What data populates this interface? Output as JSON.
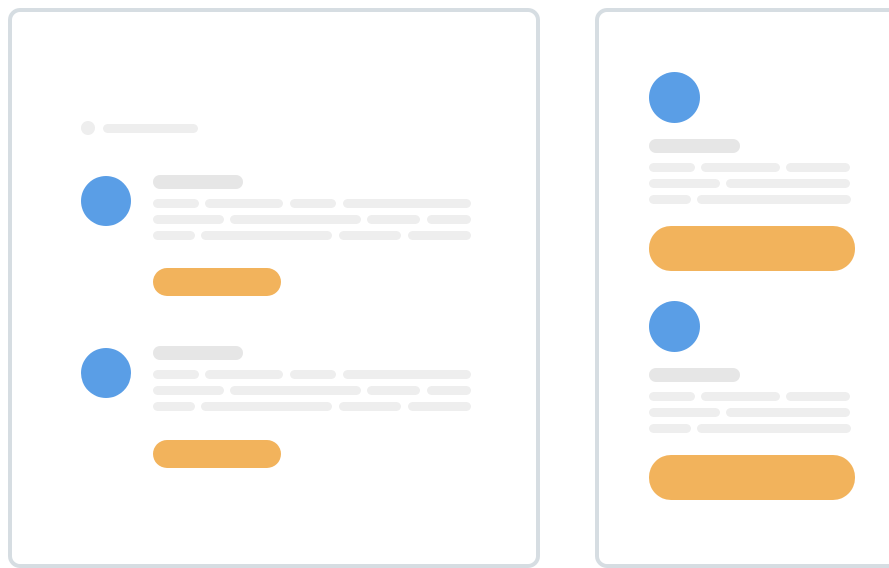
{
  "colors": {
    "frame_border": "#d6dde2",
    "avatar": "#5a9ee6",
    "cta": "#f2b35c",
    "placeholder": "#eeeeee",
    "background": "#ffffff"
  },
  "desktop_layout": {
    "header_placeholder": "breadcrumb-dot-and-text",
    "cards": [
      {
        "avatar": "avatar-icon",
        "title": "placeholder-title",
        "lines": 3,
        "cta": "button"
      },
      {
        "avatar": "avatar-icon",
        "title": "placeholder-title",
        "lines": 3,
        "cta": "button"
      }
    ]
  },
  "mobile_layout": {
    "cards": [
      {
        "avatar": "avatar-icon",
        "title": "placeholder-title",
        "lines": 3,
        "cta": "button"
      },
      {
        "avatar": "avatar-icon",
        "title": "placeholder-title",
        "lines": 3,
        "cta": "button"
      }
    ]
  }
}
